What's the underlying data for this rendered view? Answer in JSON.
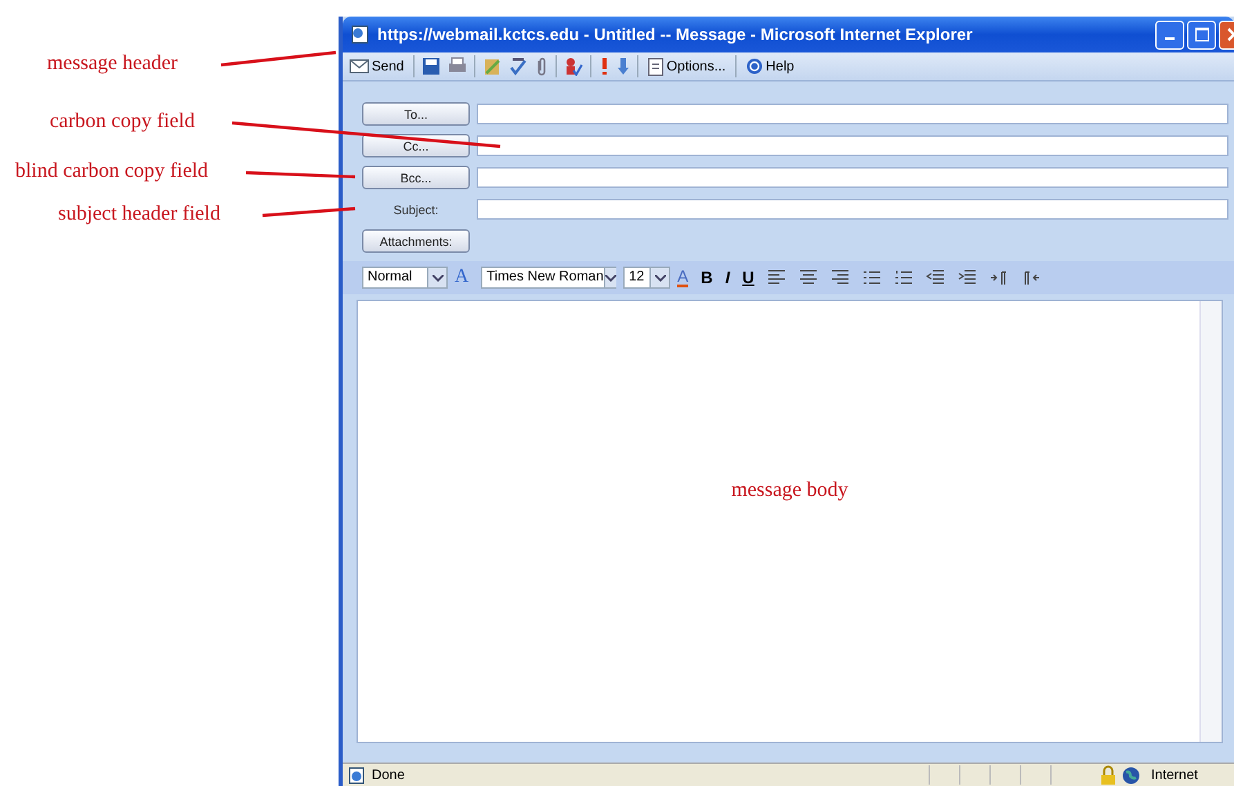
{
  "annotations": [
    {
      "label": "message header"
    },
    {
      "label": "carbon copy field"
    },
    {
      "label": "blind carbon copy field"
    },
    {
      "label": "subject header field"
    }
  ],
  "window": {
    "title": "https://webmail.kctcs.edu - Untitled -- Message - Microsoft Internet Explorer"
  },
  "toolbar": {
    "send": "Send",
    "options": "Options...",
    "help": "Help"
  },
  "address_fields": [
    {
      "kind": "button",
      "label": "To..."
    },
    {
      "kind": "button",
      "label": "Cc..."
    },
    {
      "kind": "button",
      "label": "Bcc..."
    },
    {
      "kind": "label",
      "label": "Subject:"
    }
  ],
  "attachments_button": "Attachments:",
  "format_bar": [
    {
      "kind": "select",
      "value": "Normal"
    },
    {
      "kind": "glyph",
      "label": "A"
    },
    {
      "kind": "select",
      "value": "Times New Roman"
    },
    {
      "kind": "select",
      "value": "12"
    },
    {
      "kind": "glyph",
      "label": "A"
    },
    {
      "kind": "glyph",
      "label": "B"
    },
    {
      "kind": "glyph",
      "label": "I"
    },
    {
      "kind": "glyph",
      "label": "U"
    }
  ],
  "body_annotation": "message body",
  "status_bar": {
    "text": "Done",
    "zone": "Internet"
  }
}
